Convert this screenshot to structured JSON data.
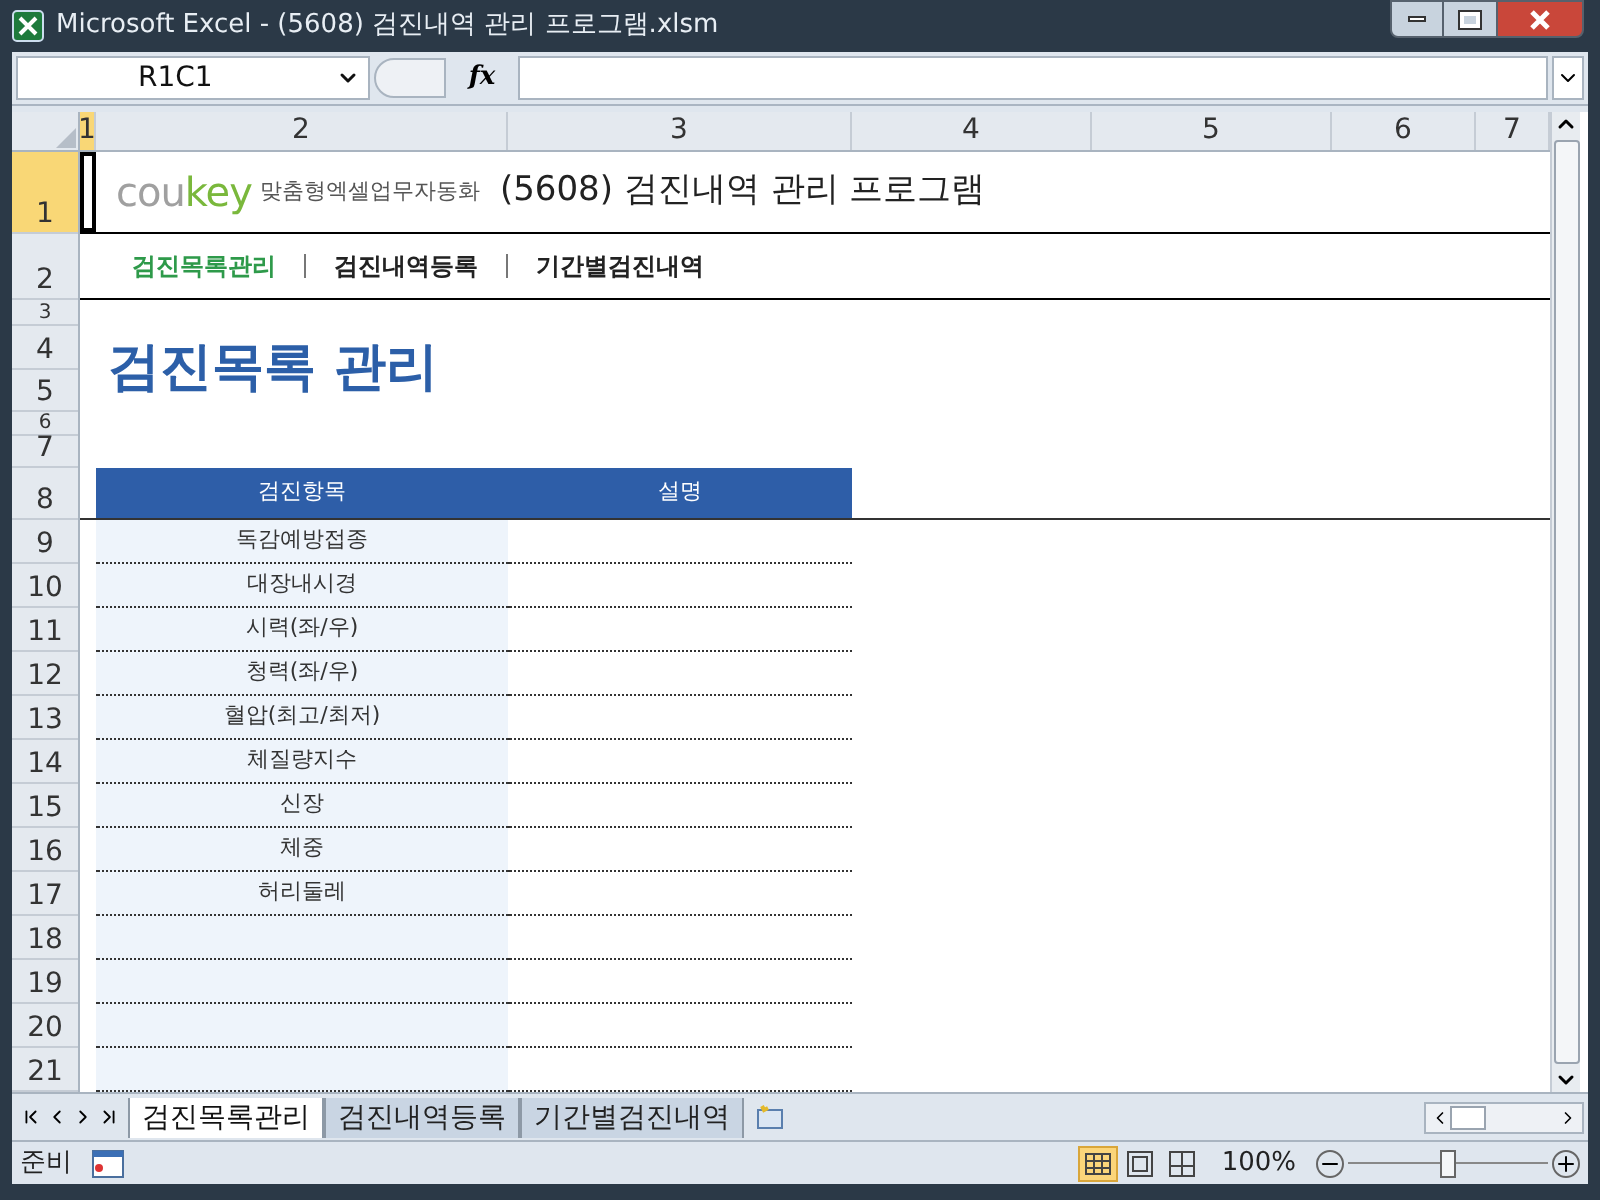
{
  "window": {
    "title": "Microsoft Excel - (5608) 검진내역 관리 프로그램.xlsm"
  },
  "formula_bar": {
    "name_box": "R1C1",
    "function_label": "fx"
  },
  "column_headers": [
    {
      "label": "1",
      "selected": true
    },
    {
      "label": "2",
      "selected": false
    },
    {
      "label": "3",
      "selected": false
    },
    {
      "label": "4",
      "selected": false
    },
    {
      "label": "5",
      "selected": false
    },
    {
      "label": "6",
      "selected": false
    },
    {
      "label": "7",
      "selected": false
    }
  ],
  "row_headers": [
    {
      "label": "1",
      "selected": true
    },
    {
      "label": "2",
      "selected": false
    },
    {
      "label": "3",
      "selected": false
    },
    {
      "label": "4",
      "selected": false
    },
    {
      "label": "5",
      "selected": false
    },
    {
      "label": "6",
      "selected": false
    },
    {
      "label": "7",
      "selected": false
    },
    {
      "label": "8",
      "selected": false
    },
    {
      "label": "9",
      "selected": false
    },
    {
      "label": "10",
      "selected": false
    },
    {
      "label": "11",
      "selected": false
    },
    {
      "label": "12",
      "selected": false
    },
    {
      "label": "13",
      "selected": false
    },
    {
      "label": "14",
      "selected": false
    },
    {
      "label": "15",
      "selected": false
    },
    {
      "label": "16",
      "selected": false
    },
    {
      "label": "17",
      "selected": false
    },
    {
      "label": "18",
      "selected": false
    },
    {
      "label": "19",
      "selected": false
    },
    {
      "label": "20",
      "selected": false
    },
    {
      "label": "21",
      "selected": false
    }
  ],
  "banner": {
    "logo_gray": "cou",
    "logo_green": "key",
    "tagline": "맞춤형엑셀업무자동화",
    "title": "(5608) 검진내역 관리 프로그램"
  },
  "nav": [
    {
      "label": "검진목록관리",
      "selected": true
    },
    {
      "label": "검진내역등록",
      "selected": false
    },
    {
      "label": "기간별검진내역",
      "selected": false
    }
  ],
  "heading": "검진목록 관리",
  "table": {
    "columns": [
      "검진항목",
      "설명"
    ],
    "rows": [
      "독감예방접종",
      "대장내시경",
      "시력(좌/우)",
      "청력(좌/우)",
      "혈압(최고/최저)",
      "체질량지수",
      "신장",
      "체중",
      "허리둘레"
    ]
  },
  "sheet_tabs": [
    {
      "label": "검진목록관리",
      "selected": true
    },
    {
      "label": "검진내역등록",
      "selected": false
    },
    {
      "label": "기간별검진내역",
      "selected": false
    }
  ],
  "status_bar": {
    "mode": "준비",
    "views": [
      {
        "kind": "normal",
        "selected": true
      },
      {
        "kind": "page_layout",
        "selected": false
      },
      {
        "kind": "page_break",
        "selected": false
      }
    ],
    "zoom": "100%",
    "zoom_slider": {
      "level": 0.5
    }
  }
}
